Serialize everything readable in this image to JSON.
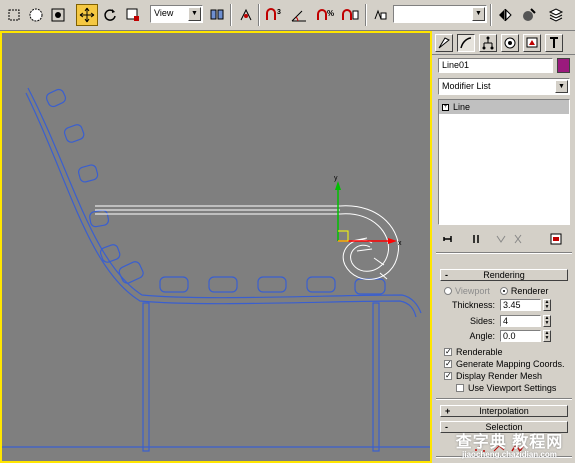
{
  "toolbar": {
    "view_select": "View",
    "named_selection": "",
    "icons": [
      "undo-icon",
      "select-icon",
      "select-region-icon",
      "move-icon",
      "rotate-icon",
      "scale-icon",
      "reference-coord-icon",
      "pivot-icon",
      "snap-3d-icon",
      "angle-snap-icon",
      "percent-snap-icon",
      "spinner-snap-icon",
      "named-selection-icon",
      "mirror-icon",
      "align-icon",
      "layers-icon"
    ]
  },
  "panel": {
    "object_name": "Line01",
    "object_color": "#9b1a7d",
    "modifier_list": "Modifier List",
    "stack": [
      {
        "label": "Line",
        "expander": "+"
      }
    ],
    "rendering": {
      "title": "Rendering",
      "viewport_label": "Viewport",
      "renderer_label": "Renderer",
      "thickness_label": "Thickness:",
      "thickness_value": "3.45",
      "sides_label": "Sides:",
      "sides_value": "4",
      "angle_label": "Angle:",
      "angle_value": "0.0",
      "renderable": "Renderable",
      "mapping": "Generate Mapping Coords.",
      "display_mesh": "Display Render Mesh",
      "use_viewport": "Use Viewport Settings"
    },
    "interpolation": {
      "title": "Interpolation",
      "sign": "+"
    },
    "selection": {
      "title": "Selection",
      "sign": "-"
    },
    "rendering_sign": "-"
  },
  "watermark": {
    "line1": "查字典 教程网",
    "line2": "jiaocheng.chazidian.com"
  }
}
